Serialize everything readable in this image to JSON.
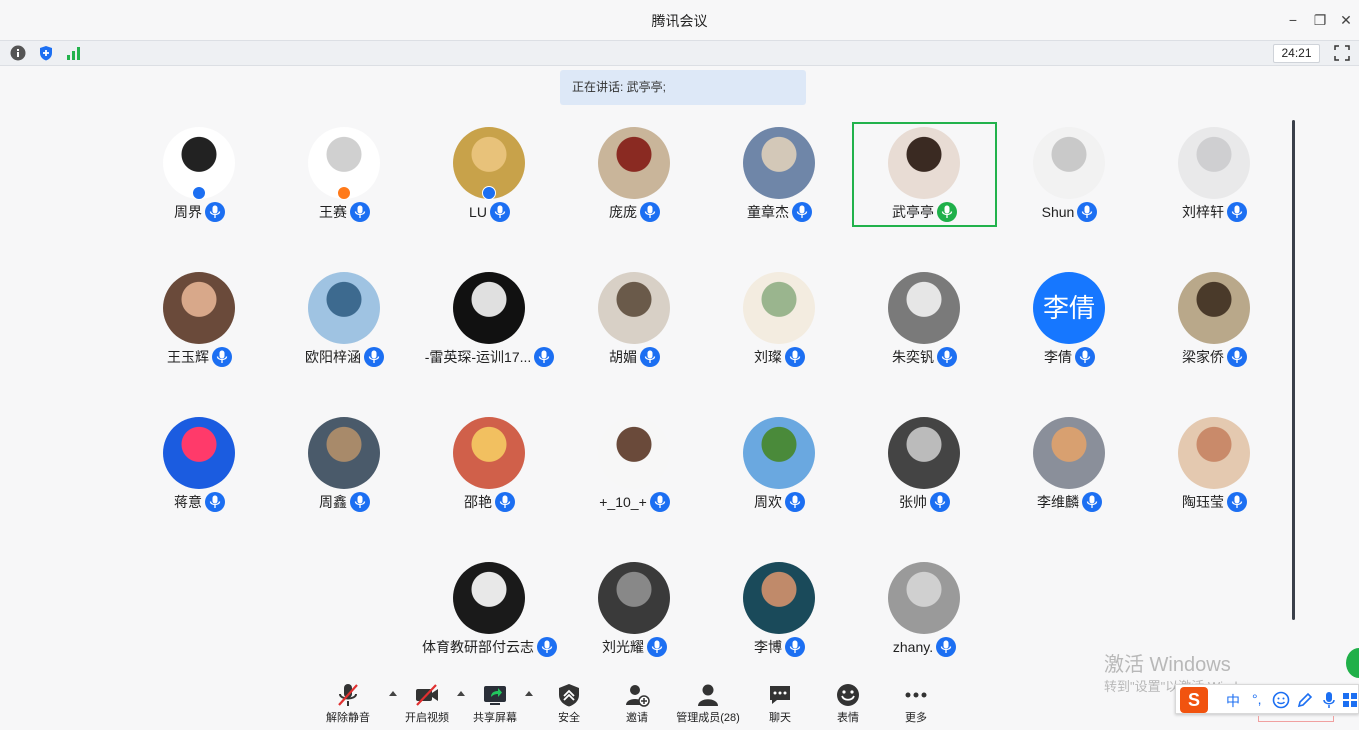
{
  "window": {
    "title": "腾讯会议",
    "minimize": "−",
    "restore": "❐",
    "close": "✕"
  },
  "status": {
    "timer": "24:21"
  },
  "speaking": {
    "text": "正在讲话: 武亭亭;"
  },
  "participants": [
    {
      "name": "周界",
      "role": "cohost"
    },
    {
      "name": "王赛",
      "role": "host"
    },
    {
      "name": "LU",
      "role": "cohost"
    },
    {
      "name": "庞庞"
    },
    {
      "name": "童章杰"
    },
    {
      "name": "武亭亭",
      "speaking": true
    },
    {
      "name": "Shun"
    },
    {
      "name": "刘梓轩"
    },
    {
      "name": "王玉辉"
    },
    {
      "name": "欧阳梓涵"
    },
    {
      "name": "-雷英琛-运训17..."
    },
    {
      "name": "胡媚"
    },
    {
      "name": "刘璨"
    },
    {
      "name": "朱奕钒"
    },
    {
      "name": "李倩",
      "initials": "李倩"
    },
    {
      "name": "梁家侨"
    },
    {
      "name": "蒋意"
    },
    {
      "name": "周鑫"
    },
    {
      "name": "邵艳"
    },
    {
      "name": "+_10_+"
    },
    {
      "name": "周欢"
    },
    {
      "name": "张帅"
    },
    {
      "name": "李维麟"
    },
    {
      "name": "陶珏莹"
    },
    {
      "name": "体育教研部付云志"
    },
    {
      "name": "刘光耀"
    },
    {
      "name": "李博"
    },
    {
      "name": "zhany."
    }
  ],
  "toolbar": {
    "mute": "解除静音",
    "video": "开启视频",
    "share": "共享屏幕",
    "security": "安全",
    "invite": "邀请",
    "members": "管理成员(28)",
    "chat": "聊天",
    "emoji": "表情",
    "more": "更多"
  },
  "watermark": {
    "line1": "激活 Windows",
    "line2": "转到\"设置\"以激活 Windows。"
  },
  "ime": {
    "logo": "S",
    "lang": "中",
    "punct": "°,"
  },
  "colors": {
    "accent": "#1c6ff2",
    "speaking": "#22b24c",
    "host": "#ff7a1a"
  }
}
